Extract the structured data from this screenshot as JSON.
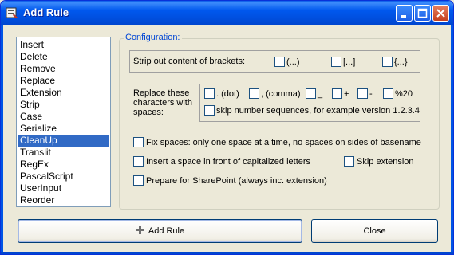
{
  "window": {
    "title": "Add Rule"
  },
  "rules_list": {
    "items": [
      "Insert",
      "Delete",
      "Remove",
      "Replace",
      "Extension",
      "Strip",
      "Case",
      "Serialize",
      "CleanUp",
      "Translit",
      "RegEx",
      "PascalScript",
      "UserInput",
      "Reorder"
    ],
    "selected": "CleanUp"
  },
  "config": {
    "group_label": "Configuration:",
    "strip_label": "Strip out content of brackets:",
    "brackets": [
      "(...)",
      "[...]",
      "{...}"
    ],
    "replace_label_lines": [
      "Replace these",
      "characters with",
      "spaces:"
    ],
    "replace_chars": [
      ". (dot)",
      ", (comma)",
      "_",
      "+",
      "-",
      "%20"
    ],
    "skip_numbers_label": "skip number sequences, for example version 1.2.3.4",
    "fix_spaces_label": "Fix spaces: only one space at a time, no spaces on sides of basename",
    "insert_space_label": "Insert a space in front of capitalized letters",
    "skip_extension_label": "Skip extension",
    "sharepoint_label": "Prepare for SharePoint (always inc. extension)"
  },
  "buttons": {
    "add_rule": "Add Rule",
    "close": "Close"
  },
  "colors": {
    "title_bar": "#0058EE",
    "selection": "#316AC5",
    "group_label": "#0046D5"
  }
}
